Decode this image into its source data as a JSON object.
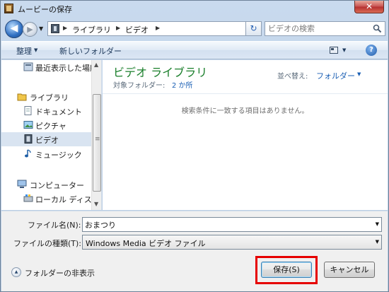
{
  "window": {
    "title": "ムービーの保存",
    "close_glyph": "✕"
  },
  "address": {
    "back_glyph": "◀",
    "forward_glyph": "▶",
    "breadcrumb": [
      "ライブラリ",
      "ビデオ"
    ],
    "search_placeholder": "ビデオの検索"
  },
  "toolbar": {
    "organize_label": "整理",
    "new_folder_label": "新しいフォルダー",
    "help_glyph": "?"
  },
  "nav": {
    "items": [
      {
        "label": "最近表示した場所",
        "icon": "recent-places-icon"
      },
      {
        "label": "ライブラリ",
        "icon": "libraries-icon"
      },
      {
        "label": "ドキュメント",
        "icon": "documents-icon"
      },
      {
        "label": "ピクチャ",
        "icon": "pictures-icon"
      },
      {
        "label": "ビデオ",
        "icon": "videos-icon",
        "selected": true
      },
      {
        "label": "ミュージック",
        "icon": "music-icon"
      },
      {
        "label": "コンピューター",
        "icon": "computer-icon"
      },
      {
        "label": "ローカル ディスク",
        "icon": "local-disk-icon"
      }
    ]
  },
  "content": {
    "library_title": "ビデオ ライブラリ",
    "target_folder_label": "対象フォルダー:",
    "target_folder_value": "2 か所",
    "arrange_label": "並べ替え:",
    "arrange_value": "フォルダー",
    "empty_message": "検索条件に一致する項目はありません。"
  },
  "form": {
    "filename_label": "ファイル名(N):",
    "filename_value": "おまつり",
    "filetype_label": "ファイルの種類(T):",
    "filetype_value": "Windows Media ビデオ ファイル",
    "hide_folders_label": "フォルダーの非表示",
    "save_label": "保存(S)",
    "cancel_label": "キャンセル"
  },
  "colors": {
    "highlight": "#e60000",
    "library_title": "#1a7f2b",
    "link": "#1a5fb4"
  }
}
